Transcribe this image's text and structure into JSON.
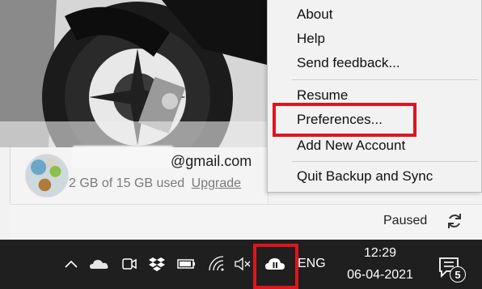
{
  "account": {
    "email": "@gmail.com",
    "storage_text": "2 GB of 15 GB used",
    "upgrade_label": "Upgrade"
  },
  "status": {
    "text": "Paused",
    "icon": "sync-icon"
  },
  "context_menu": {
    "about": "About",
    "help": "Help",
    "send_feedback": "Send feedback...",
    "resume": "Resume",
    "preferences": "Preferences...",
    "add_account": "Add New Account",
    "quit": "Quit Backup and Sync",
    "highlighted_item": "Preferences..."
  },
  "taskbar": {
    "tray_icons": [
      "chevron-up-icon",
      "onedrive-icon",
      "meet-now-icon",
      "dropbox-icon",
      "battery-icon",
      "wifi-icon",
      "volume-muted-icon",
      "backup-and-sync-paused-icon"
    ],
    "highlighted_icon": "backup-and-sync-paused-icon",
    "language": "ENG",
    "time": "12:29",
    "date": "06-04-2021",
    "notification_count": "5"
  },
  "colors": {
    "highlight": "#e0141e",
    "taskbar": "#1f1f1f",
    "menu_bg": "#f2f2f2"
  }
}
